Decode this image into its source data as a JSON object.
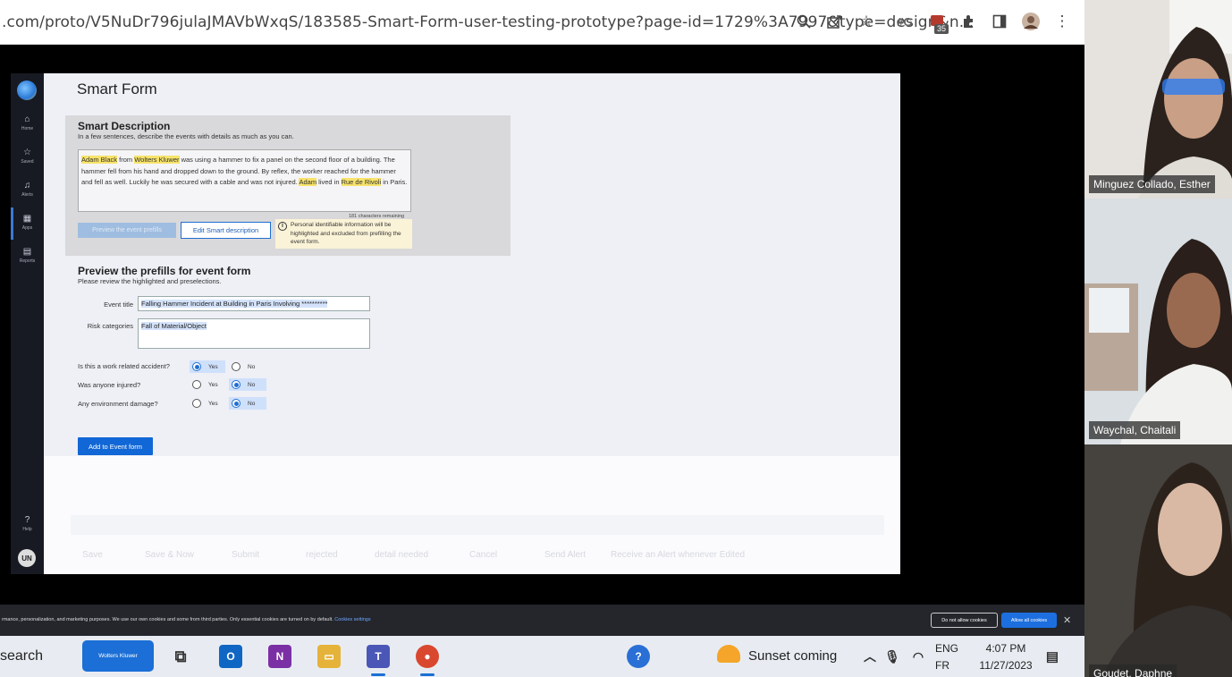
{
  "browser": {
    "url": ".com/proto/V5NuDr796julaJMAVbWxqS/183585-Smart-Form-user-testing-prototype?page-id=1729%3A7997&type=design&n...",
    "extension_badge": "35",
    "toolbar_icons": [
      "zoom-icon",
      "share-icon",
      "star-icon",
      "extension-g-icon",
      "extension-badge-icon",
      "puzzle-icon",
      "sidepanel-icon",
      "profile-avatar",
      "kebab-menu-icon"
    ]
  },
  "sidebar": {
    "items": [
      {
        "label": "Home",
        "icon": "home-icon"
      },
      {
        "label": "Saved",
        "icon": "star-icon"
      },
      {
        "label": "Alerts",
        "icon": "bell-icon"
      },
      {
        "label": "Apps",
        "icon": "grid-icon"
      },
      {
        "label": "Reports",
        "icon": "chart-icon"
      }
    ],
    "help": "Help",
    "user_initials": "UN"
  },
  "page": {
    "title": "Smart Form"
  },
  "smart_description": {
    "heading": "Smart Description",
    "instruction": "In a few sentences,  describe the events with details as much as you can.",
    "text_parts": [
      {
        "t": "Adam Black",
        "h": true
      },
      {
        "t": " from ",
        "h": false
      },
      {
        "t": "Wolters Kluwer",
        "h": true
      },
      {
        "t": " was using a hammer to fix a panel on the second floor of a building. The hammer fell from his hand and dropped down to the ground. By reflex, the worker reached for the hammer and fell as well. Luckily he was secured with a cable and was not injured. ",
        "h": false
      },
      {
        "t": "Adam",
        "h": true
      },
      {
        "t": " lived in ",
        "h": false
      },
      {
        "t": "Rue de Rivoli",
        "h": true
      },
      {
        "t": " in Paris.",
        "h": false
      }
    ],
    "counter": "181 characters remaining",
    "preview_button": "Preview the event prefills",
    "edit_button": "Edit  Smart description",
    "pii_notice": "Personal identifiable information will be highlighted and excluded from prefilling the event form."
  },
  "preview": {
    "heading": "Preview the prefills for event form",
    "instruction": "Please review the highlighted and preselections.",
    "event_title_label": "Event title",
    "event_title_value": "Falling Hammer Incident at Building in Paris Involving **********",
    "risk_label": "Risk categories",
    "risk_value": "Fall of Material/Object",
    "questions": [
      {
        "q": "Is this a work related accident?",
        "selected": "Yes"
      },
      {
        "q": "Was anyone injured?",
        "selected": "No"
      },
      {
        "q": "Any environment damage?",
        "selected": "No"
      }
    ],
    "yes": "Yes",
    "no": "No",
    "add_button": "Add to Event form"
  },
  "faded_actions": [
    "Save",
    "Save & Now",
    "Submit",
    "rejected",
    "detail needed",
    "Cancel",
    "Send Alert",
    "Receive an Alert whenever Edited"
  ],
  "cookie_bar": {
    "text": "rmance, personalization, and marketing purposes. We use our own cookies and some from third parties. Only essential cookies are turned on by default.",
    "link": "Cookies settings",
    "deny": "Do not allow cookies",
    "allow": "Allow all cookies"
  },
  "taskbar": {
    "search": "search",
    "pinned_app": "Wolters Kluwer",
    "weather": "Sunset coming",
    "lang1": "ENG",
    "lang2": "FR",
    "time": "4:07 PM",
    "date": "11/27/2023"
  },
  "participants": [
    "Minguez Collado, Esther",
    "Waychal, Chaitali",
    "Goudet, Daphne"
  ],
  "colors": {
    "accent": "#1167d6",
    "highlight": "#f7e36b",
    "sidebar": "#171a22"
  }
}
